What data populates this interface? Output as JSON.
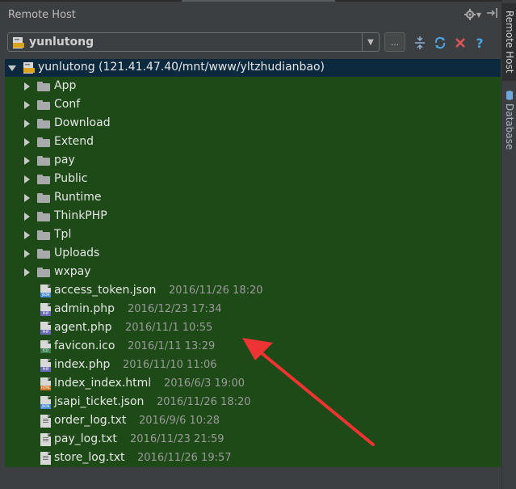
{
  "panel": {
    "title": "Remote Host"
  },
  "right_tabs": {
    "active": "Remote Host",
    "second": "Database"
  },
  "combo": {
    "value": "yunlutong"
  },
  "toolbar": {
    "more_label": "..."
  },
  "root": {
    "label": "yunlutong (121.41.47.40/mnt/www/yltzhudianbao)"
  },
  "folders": [
    {
      "name": "App"
    },
    {
      "name": "Conf"
    },
    {
      "name": "Download"
    },
    {
      "name": "Extend"
    },
    {
      "name": "pay"
    },
    {
      "name": "Public"
    },
    {
      "name": "Runtime"
    },
    {
      "name": "ThinkPHP"
    },
    {
      "name": "Tpl"
    },
    {
      "name": "Uploads"
    },
    {
      "name": "wxpay"
    }
  ],
  "files": [
    {
      "name": "access_token.json",
      "date": "2016/11/26 18:20",
      "kind": "json"
    },
    {
      "name": "admin.php",
      "date": "2016/12/23 17:34",
      "kind": "php"
    },
    {
      "name": "agent.php",
      "date": "2016/11/1 10:55",
      "kind": "php"
    },
    {
      "name": "favicon.ico",
      "date": "2016/1/11 13:29",
      "kind": "ico"
    },
    {
      "name": "index.php",
      "date": "2016/11/10 11:06",
      "kind": "php"
    },
    {
      "name": "Index_index.html",
      "date": "2016/6/3 19:00",
      "kind": "html"
    },
    {
      "name": "jsapi_ticket.json",
      "date": "2016/11/26 18:20",
      "kind": "json"
    },
    {
      "name": "order_log.txt",
      "date": "2016/9/6 10:28",
      "kind": "txt"
    },
    {
      "name": "pay_log.txt",
      "date": "2016/11/23 21:59",
      "kind": "txt"
    },
    {
      "name": "store_log.txt",
      "date": "2016/11/26 19:57",
      "kind": "txt"
    }
  ],
  "colors": {
    "tree_bg": "#1d4a17",
    "root_selection": "#0d293e",
    "close_red": "#e05555",
    "sync_blue": "#4aa3df",
    "annotation_arrow": "#ee3333"
  }
}
